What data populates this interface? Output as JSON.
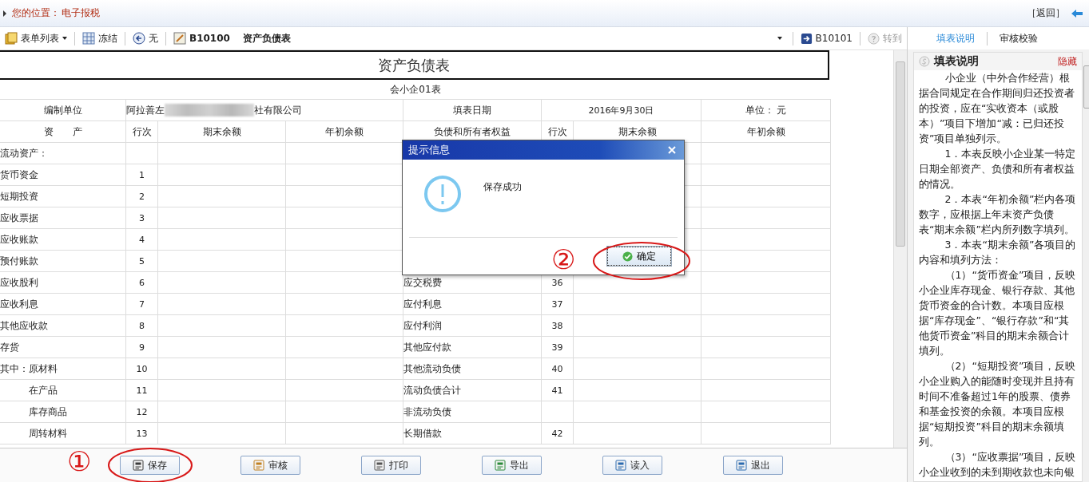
{
  "location": {
    "label": "您的位置：",
    "value": "电子报税",
    "back": "［返回］"
  },
  "toolbar": {
    "items": [
      {
        "kind": "menu",
        "label": "表单列表"
      },
      {
        "kind": "freeze",
        "label": "冻结"
      },
      {
        "kind": "prev",
        "label": "无"
      },
      {
        "kind": "form",
        "label": "B10100"
      }
    ],
    "form_title": "资产负债表",
    "next": "B10101",
    "goto": {
      "label": "转到",
      "disabled": true
    }
  },
  "table": {
    "title": "资产负债表",
    "code": "会小企01表",
    "info": {
      "unit_label": "编制单位",
      "unit_start": "阿拉善左",
      "unit_end": "社有限公司",
      "date_label": "填表日期",
      "date": "2016年9月30日",
      "currency": "单位：  元"
    },
    "columns": [
      "资　　产",
      "行次",
      "期末余额",
      "年初余额",
      "负债和所有者权益",
      "行次",
      "期末余额",
      "年初余额"
    ],
    "rows": [
      {
        "kind": "normal",
        "asset": "流动资产：",
        "line": ""
      },
      {
        "kind": "normal",
        "asset": "货币资金",
        "line": "1"
      },
      {
        "kind": "normal",
        "asset": "短期投资",
        "line": "2"
      },
      {
        "kind": "normal",
        "asset": "应收票据",
        "line": "3"
      },
      {
        "kind": "normal",
        "asset": "应收账款",
        "line": "4"
      },
      {
        "kind": "normal",
        "asset": "预付账款",
        "line": "5"
      },
      {
        "kind": "normal",
        "asset": "应收股利",
        "line": "6",
        "liability": "应交税费",
        "liability_line": "36"
      },
      {
        "kind": "normal",
        "asset": "应收利息",
        "line": "7",
        "liability": "应付利息",
        "liability_line": "37"
      },
      {
        "kind": "normal",
        "asset": "其他应收款",
        "line": "8",
        "liability": "应付利润",
        "liability_line": "38"
      },
      {
        "kind": "normal",
        "asset": "存货",
        "line": "9",
        "liability": "其他应付款",
        "liability_line": "39"
      },
      {
        "kind": "normal",
        "asset": "其中：原材料",
        "line": "10",
        "liability": "其他流动负债",
        "liability_line": "40"
      },
      {
        "kind": "indented",
        "asset": "在产品",
        "line": "11",
        "liability": "流动负债合计",
        "liability_line": "41"
      },
      {
        "kind": "indented",
        "asset": "库存商品",
        "line": "12",
        "liability": "非流动负债"
      },
      {
        "kind": "indented",
        "asset": "周转材料",
        "line": "13",
        "liability": "长期借款",
        "liability_line": "42"
      }
    ]
  },
  "buttons": [
    {
      "kind": "save",
      "label": "保存"
    },
    {
      "kind": "audit",
      "label": "审核"
    },
    {
      "kind": "print",
      "label": "打印"
    },
    {
      "kind": "export",
      "label": "导出"
    },
    {
      "kind": "import",
      "label": "读入"
    },
    {
      "kind": "exit",
      "label": "退出"
    }
  ],
  "dialog": {
    "title": "提示信息",
    "message": "保存成功",
    "ok": "确定"
  },
  "annotations": [
    {
      "label": "①"
    },
    {
      "label": "②"
    }
  ],
  "side_tabs": [
    {
      "label": "填表说明",
      "selected": true
    },
    {
      "label": "审核校验",
      "selected": false
    }
  ],
  "help": {
    "title": "填表说明",
    "hide": "隐藏",
    "paragraphs": [
      "小企业（中外合作经营）根据合同规定在合作期间归还投资者的投资，应在“实收资本（或股本）”项目下增加“减：已归还投资”项目单独列示。",
      "1．本表反映小企业某一特定日期全部资产、负债和所有者权益的情况。",
      "2．本表“年初余额”栏内各项数字，应根据上年末资产负债表“期末余额”栏内所列数字填列。",
      "3．本表“期末余额”各项目的内容和填列方法：",
      "（1）“货币资金”项目，反映小企业库存现金、银行存款、其他货币资金的合计数。本项目应根据“库存现金”、“银行存款”和“其他货币资金”科目的期末余额合计填列。",
      "（2）“短期投资”项目，反映小企业购入的能随时变现并且持有时间不准备超过1年的股票、债券和基金投资的余额。本项目应根据“短期投资”科目的期末余额填列。",
      "（3）“应收票据”项目，反映小企业收到的未到期收款也未向银"
    ]
  }
}
